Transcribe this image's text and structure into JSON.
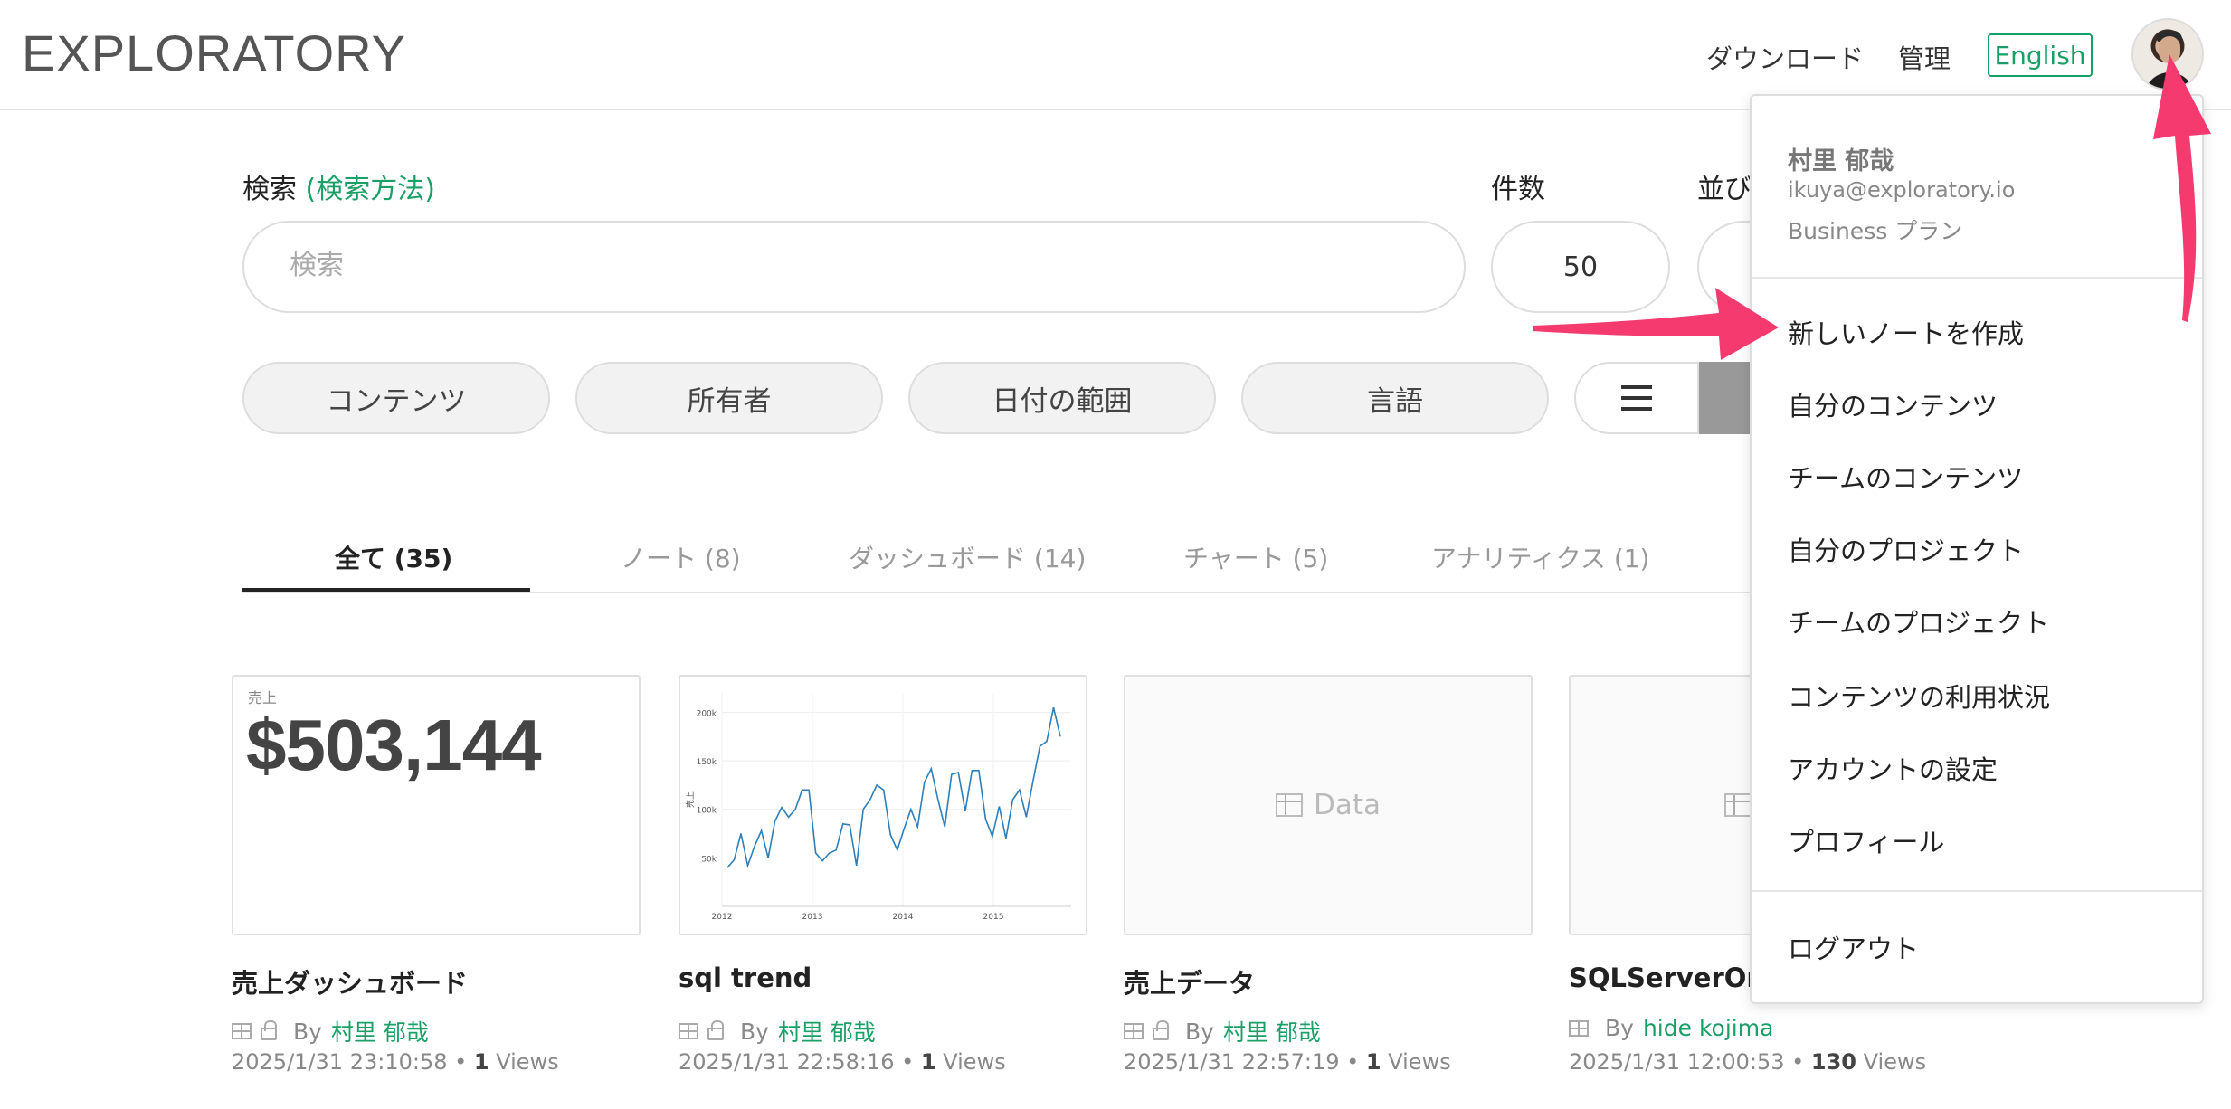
{
  "header": {
    "logo": "EXPLORATORY",
    "download": "ダウンロード",
    "admin": "管理",
    "language": "English"
  },
  "search": {
    "label": "検索",
    "help_link": "(検索方法)",
    "placeholder": "検索",
    "count_label": "件数",
    "count_value": "50",
    "sort_label": "並び"
  },
  "filters": [
    "コンテンツ",
    "所有者",
    "日付の範囲",
    "言語"
  ],
  "tabs": [
    "全て (35)",
    "ノート (8)",
    "ダッシュボード (14)",
    "チャート (5)",
    "アナリティクス (1)"
  ],
  "cards": [
    {
      "title": "売上ダッシュボード",
      "by": "By",
      "author": "村里 郁哉",
      "date": "2025/1/31 23:10:58",
      "views_count": "1",
      "views_label": "Views",
      "kpi_label": "売上",
      "kpi_value": "$503,144"
    },
    {
      "title": "sql trend",
      "by": "By",
      "author": "村里 郁哉",
      "date": "2025/1/31 22:58:16",
      "views_count": "1",
      "views_label": "Views"
    },
    {
      "title": "売上データ",
      "by": "By",
      "author": "村里 郁哉",
      "date": "2025/1/31 22:57:19",
      "views_count": "1",
      "views_label": "Views",
      "thumb_label": "Data"
    },
    {
      "title": "SQLServerOrde",
      "by": "By",
      "author": "hide kojima",
      "date": "2025/1/31 12:00:53",
      "views_count": "130",
      "views_label": "Views"
    }
  ],
  "mini_chart": {
    "yticks": [
      "200k",
      "150k",
      "100k",
      "50k"
    ],
    "xticks": [
      "2012",
      "2013",
      "2014",
      "2015"
    ],
    "ylabel": "売上",
    "values": [
      40,
      48,
      75,
      42,
      62,
      78,
      50,
      88,
      102,
      92,
      100,
      120,
      120,
      55,
      47,
      55,
      58,
      85,
      84,
      42,
      100,
      110,
      125,
      120,
      74,
      58,
      80,
      100,
      82,
      128,
      142,
      110,
      82,
      136,
      138,
      98,
      140,
      140,
      90,
      72,
      103,
      70,
      110,
      120,
      92,
      130,
      165,
      170,
      205,
      175
    ]
  },
  "account_menu": {
    "name": "村里 郁哉",
    "email": "ikuya@exploratory.io",
    "plan": "Business プラン",
    "items": [
      "新しいノートを作成",
      "自分のコンテンツ",
      "チームのコンテンツ",
      "自分のプロジェクト",
      "チームのプロジェクト",
      "コンテンツの利用状況",
      "アカウントの設定",
      "プロフィール"
    ],
    "logout": "ログアウト"
  },
  "colors": {
    "accent": "#1aa067",
    "annotation_arrow": "#f43a6e",
    "chart_line": "#2c7fb8"
  }
}
